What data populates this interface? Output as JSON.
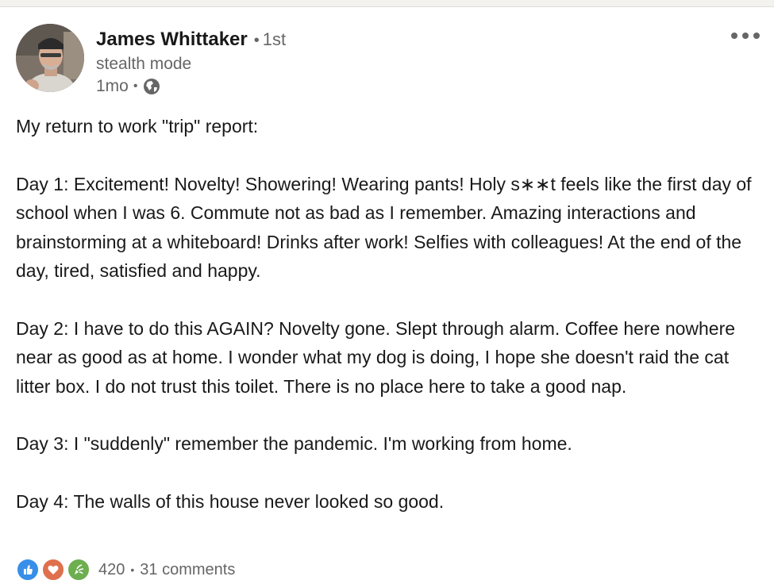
{
  "author": {
    "name": "James Whittaker",
    "separator": "•",
    "degree": "1st",
    "headline": "stealth mode",
    "time": "1mo",
    "meta_separator": "•",
    "visibility_icon": "globe-icon"
  },
  "menu": {
    "icon": "more-horizontal-icon"
  },
  "post": {
    "paragraphs": [
      "My return to work \"trip\" report:",
      "Day 1: Excitement! Novelty! Showering! Wearing pants! Holy s∗∗t feels like the first day of school when I was 6. Commute not as bad as I remember. Amazing interactions and brainstorming at a whiteboard! Drinks after work! Selfies with colleagues! At the end of the day, tired, satisfied and happy.",
      "Day 2: I have to do this AGAIN? Novelty gone. Slept through alarm. Coffee here nowhere near as good as at home. I wonder what my dog is doing, I hope she doesn't raid the cat litter box. I do not trust this toilet. There is no place here to take a good nap.",
      "Day 3: I \"suddenly\" remember the pandemic. I'm working from home.",
      "Day 4: The walls of this house never looked so good."
    ]
  },
  "social": {
    "reaction_icons": [
      "like-icon",
      "love-icon",
      "celebrate-icon"
    ],
    "reaction_count": "420",
    "separator": "•",
    "comments": "31 comments"
  },
  "colors": {
    "like": "#378fe9",
    "love": "#df704d",
    "celebrate": "#6dae4f",
    "secondary_text": "#666666"
  }
}
